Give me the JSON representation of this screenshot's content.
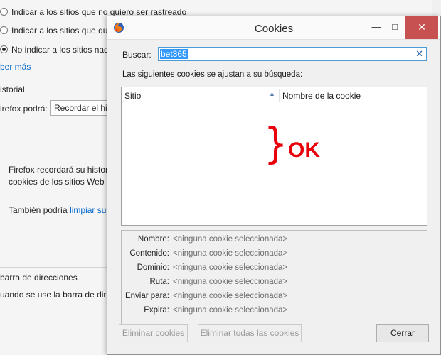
{
  "background": {
    "option_1": "Indicar a los sitios que no quiero ser rastreado",
    "option_2": "Indicar a los sitios que quiero",
    "option_3": "No indicar a los sitios nada",
    "learn_more": "ber más",
    "history_heading": "istorial",
    "firefox_will": "irefox podrá:",
    "history_select": "Recordar el hist",
    "remember_line1": "Firefox recordará su histor",
    "remember_line2": "cookies de los sitios Web o",
    "also_prefix": "También podría ",
    "also_link": "limpiar su",
    "addressbar_heading": "barra de direcciones",
    "addressbar_text": "uando se use la barra de direcc"
  },
  "dialog": {
    "title": "Cookies",
    "controls": {
      "minimize": "—",
      "maximize": "□",
      "close": "✕"
    },
    "search": {
      "label": "Buscar:",
      "value": "bet365",
      "clear_icon": "✕"
    },
    "description": "Las siguientes cookies se ajustan a su búsqueda:",
    "table": {
      "columns": [
        "Sitio",
        "Nombre de la cookie"
      ],
      "sort_indicator": "▲",
      "rows": []
    },
    "annotation": {
      "brace": "}",
      "text": "OK",
      "color": "#e8000b"
    },
    "details": [
      {
        "label": "Nombre:",
        "value": "<ninguna cookie seleccionada>"
      },
      {
        "label": "Contenido:",
        "value": "<ninguna cookie seleccionada>"
      },
      {
        "label": "Dominio:",
        "value": "<ninguna cookie seleccionada>"
      },
      {
        "label": "Ruta:",
        "value": "<ninguna cookie seleccionada>"
      },
      {
        "label": "Enviar para:",
        "value": "<ninguna cookie seleccionada>"
      },
      {
        "label": "Expira:",
        "value": "<ninguna cookie seleccionada>"
      }
    ],
    "buttons": {
      "remove_cookie": "Eliminar cookies",
      "remove_all": "Eliminar todas las cookies",
      "close": "Cerrar"
    }
  }
}
